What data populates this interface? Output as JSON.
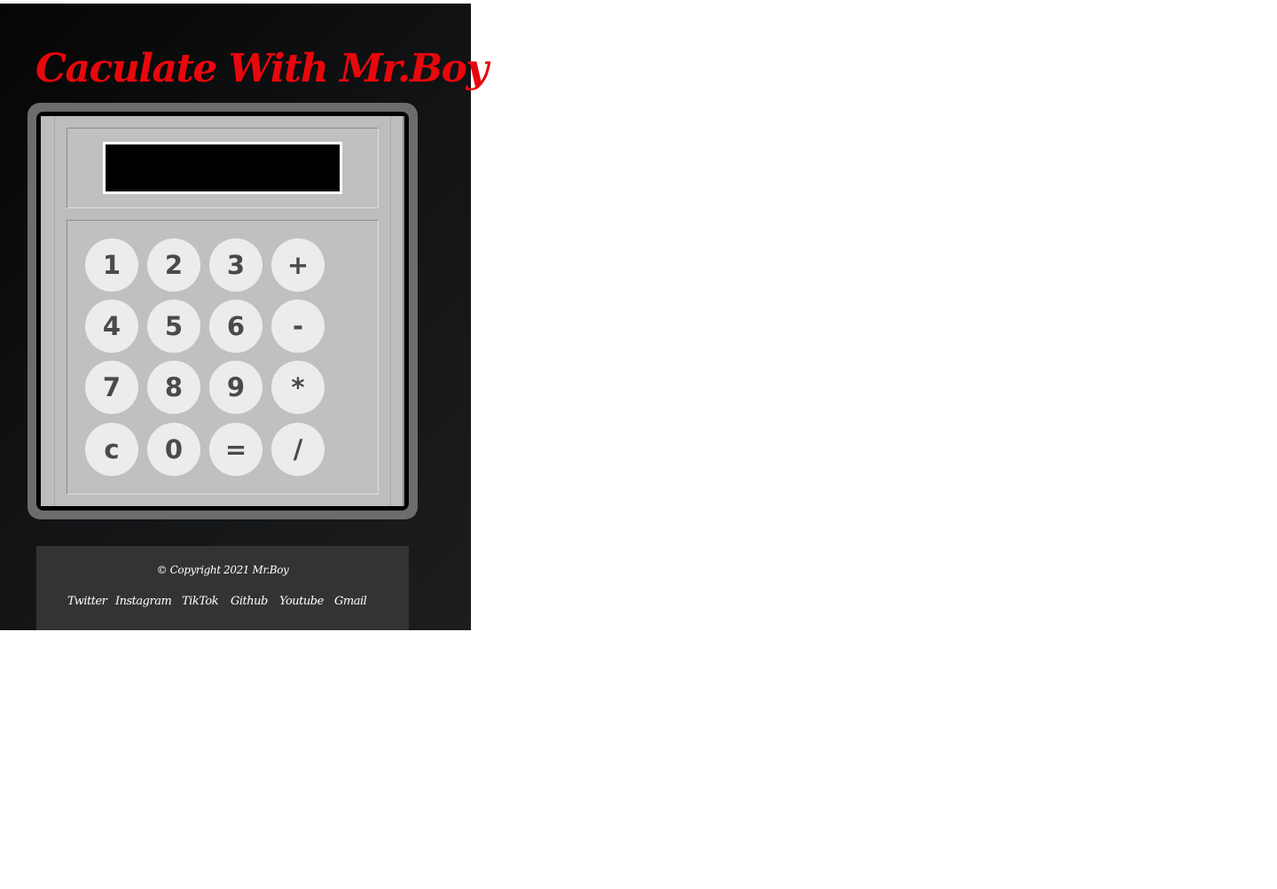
{
  "header": {
    "title": "Caculate With Mr.Boy"
  },
  "calculator": {
    "display_value": "",
    "keys": {
      "k1": "1",
      "k2": "2",
      "k3": "3",
      "plus": "+",
      "k4": "4",
      "k5": "5",
      "k6": "6",
      "minus": "-",
      "k7": "7",
      "k8": "8",
      "k9": "9",
      "multiply": "*",
      "clear": "c",
      "k0": "0",
      "equals": "=",
      "divide": "/"
    }
  },
  "footer": {
    "copyright": "© Copyright 2021 Mr.Boy",
    "links": {
      "twitter": "Twitter",
      "instagram": "Instagram",
      "tiktok": "TikTok",
      "github": "Github",
      "youtube": "Youtube",
      "gmail": "Gmail"
    }
  },
  "colors": {
    "title": "#e8070c",
    "background": "#0c0d0e",
    "calculator_body": "#bdbdbd",
    "key": "#ececee",
    "footer": "#333333"
  }
}
